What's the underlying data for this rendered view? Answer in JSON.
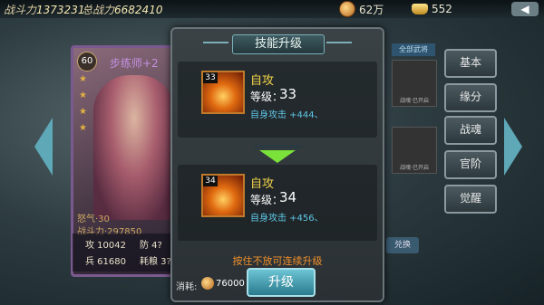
{
  "topbar": {
    "combat_power_label": "战斗力",
    "combat_power_value": "1373231",
    "total_power_label": "总战力",
    "total_power_value": "6682410",
    "coins": "62万",
    "ingots": "552",
    "back_icon": "back-arrow-icon"
  },
  "hero": {
    "level": "60",
    "name": "步练师+2",
    "stars": [
      "★",
      "★",
      "★",
      "★"
    ],
    "fetter_label": "怒气·30",
    "power_label": "战斗力·297850",
    "attack": "攻 10042",
    "defense": "防 4?",
    "troops": "兵 61680",
    "command": "耗粮 3?"
  },
  "right_menu": [
    "基本",
    "缘分",
    "战魂",
    "官阶",
    "觉醒"
  ],
  "all_generals": "全部武将",
  "thumb_caption": "战魂·已开启",
  "swap_label": "兑换",
  "dialog": {
    "title": "技能升级",
    "current": {
      "icon_level": "33",
      "name": "自攻",
      "level_label": "等级：",
      "level_value": "33",
      "effect": "自身攻击 +444、"
    },
    "next": {
      "icon_level": "34",
      "name": "自攻",
      "level_label": "等级：",
      "level_value": "34",
      "effect": "自身攻击 +456、"
    },
    "hint": "按住不放可连续升级",
    "cost_label": "消耗:",
    "cost_value": "76000",
    "upgrade_label": "升级"
  },
  "colors": {
    "accent": "#5ec8e8",
    "skill_name": "#f2d24a",
    "hint": "#f0902a",
    "arrow": "#7be23a"
  }
}
